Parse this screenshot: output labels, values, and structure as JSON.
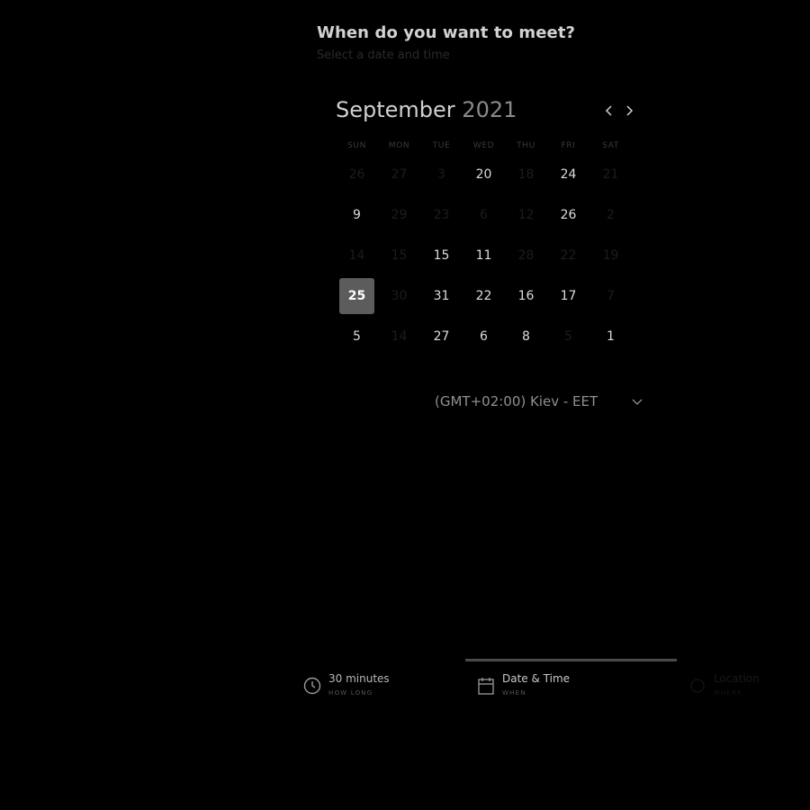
{
  "header": {
    "title": "When do you want to meet?",
    "subtitle": "Select a date and time"
  },
  "calendar": {
    "month": "September",
    "year": "2021",
    "weekdays": [
      "SUN",
      "MON",
      "TUE",
      "WED",
      "THU",
      "FRI",
      "SAT"
    ],
    "rows": [
      [
        {
          "d": "26",
          "muted": true
        },
        {
          "d": "27",
          "muted": true
        },
        {
          "d": "3",
          "muted": true
        },
        {
          "d": "20",
          "muted": false
        },
        {
          "d": "18",
          "muted": true
        },
        {
          "d": "24",
          "muted": false
        },
        {
          "d": "21",
          "muted": true
        }
      ],
      [
        {
          "d": "9",
          "muted": false
        },
        {
          "d": "29",
          "muted": true
        },
        {
          "d": "23",
          "muted": true
        },
        {
          "d": "6",
          "muted": true
        },
        {
          "d": "12",
          "muted": true
        },
        {
          "d": "26",
          "muted": false
        },
        {
          "d": "2",
          "muted": true
        }
      ],
      [
        {
          "d": "14",
          "muted": true
        },
        {
          "d": "15",
          "muted": true
        },
        {
          "d": "15",
          "muted": false
        },
        {
          "d": "11",
          "muted": false
        },
        {
          "d": "28",
          "muted": true
        },
        {
          "d": "22",
          "muted": true
        },
        {
          "d": "19",
          "muted": true
        }
      ],
      [
        {
          "d": "25",
          "muted": false,
          "selected": true
        },
        {
          "d": "30",
          "muted": true
        },
        {
          "d": "31",
          "muted": false
        },
        {
          "d": "22",
          "muted": false
        },
        {
          "d": "16",
          "muted": false
        },
        {
          "d": "17",
          "muted": false
        },
        {
          "d": "7",
          "muted": true
        }
      ],
      [
        {
          "d": "5",
          "muted": false
        },
        {
          "d": "14",
          "muted": true
        },
        {
          "d": "27",
          "muted": false
        },
        {
          "d": "6",
          "muted": false
        },
        {
          "d": "8",
          "muted": false
        },
        {
          "d": "5",
          "muted": true
        },
        {
          "d": "1",
          "muted": false
        }
      ]
    ]
  },
  "timezone": {
    "label": "(GMT+02:00) Kiev - EET"
  },
  "steps": [
    {
      "title": "30 minutes",
      "sub": "HOW LONG",
      "icon": "clock-icon"
    },
    {
      "title": "Date & Time",
      "sub": "WHEN",
      "icon": "calendar-icon"
    },
    {
      "title": "Location",
      "sub": "WHERE",
      "icon": "location-icon"
    }
  ],
  "colors": {
    "background": "#000000",
    "selected_day_bg": "#5c5c5c",
    "progress_bar": "#4a4a4a"
  }
}
